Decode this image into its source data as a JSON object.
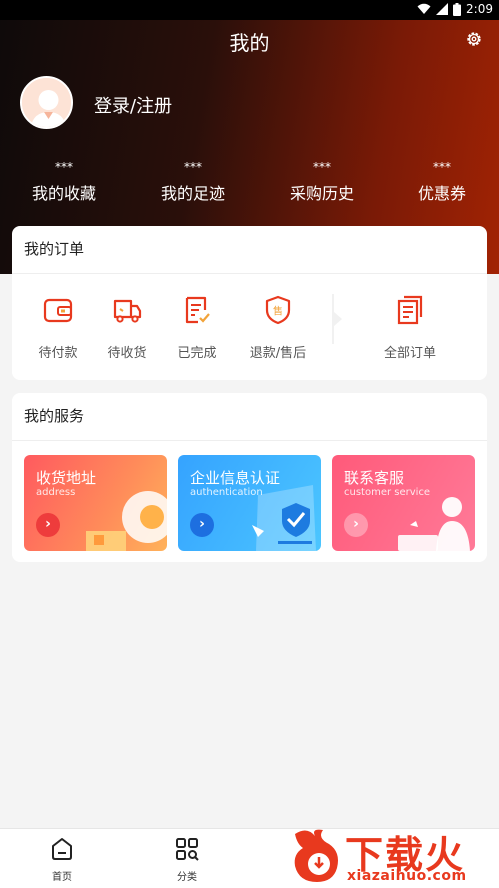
{
  "status_bar": {
    "time": "2:09"
  },
  "header": {
    "title": "我的",
    "login_label": "登录/注册"
  },
  "stats": [
    {
      "value": "***",
      "label": "我的收藏"
    },
    {
      "value": "***",
      "label": "我的足迹"
    },
    {
      "value": "***",
      "label": "采购历史"
    },
    {
      "value": "***",
      "label": "优惠券"
    }
  ],
  "orders": {
    "title": "我的订单",
    "items": [
      {
        "label": "待付款",
        "icon": "wallet-icon"
      },
      {
        "label": "待收货",
        "icon": "truck-icon"
      },
      {
        "label": "已完成",
        "icon": "checklist-icon"
      },
      {
        "label": "退款/售后",
        "icon": "shield-sale-icon"
      },
      {
        "label": "全部订单",
        "icon": "documents-icon"
      }
    ]
  },
  "services": {
    "title": "我的服务",
    "items": [
      {
        "title": "收货地址",
        "subtitle": "address"
      },
      {
        "title": "企业信息认证",
        "subtitle": "authentication"
      },
      {
        "title": "联系客服",
        "subtitle": "customer service"
      }
    ]
  },
  "tabbar": [
    {
      "label": "首页",
      "icon": "home-icon"
    },
    {
      "label": "分类",
      "icon": "category-icon"
    }
  ],
  "watermark": {
    "text": "下载火",
    "url": "xiazaihuo.com"
  },
  "colors": {
    "accent": "#e8391e",
    "header_dark": "#0e0a0a",
    "header_red": "#a22304"
  }
}
